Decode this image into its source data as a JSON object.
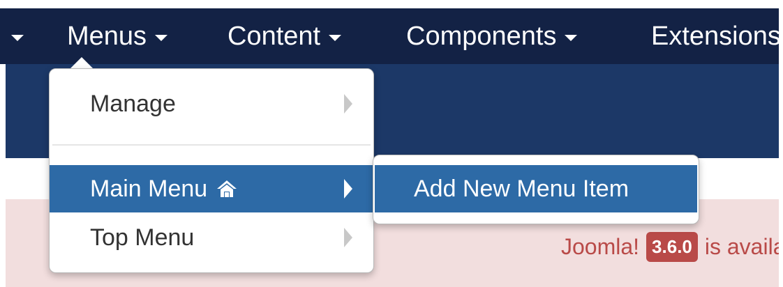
{
  "navbar": {
    "items": [
      {
        "label": "",
        "has_caret": true
      },
      {
        "label": "Menus",
        "has_caret": true
      },
      {
        "label": "Content",
        "has_caret": true
      },
      {
        "label": "Components",
        "has_caret": true
      },
      {
        "label": "Extensions",
        "has_caret": false
      }
    ]
  },
  "dropdown": {
    "items": [
      {
        "label": "Manage",
        "icon": "chevron-right-icon"
      },
      {
        "label": "Main Menu",
        "icon": "home-icon",
        "active": true
      },
      {
        "label": "Top Menu",
        "icon": "chevron-right-icon"
      }
    ]
  },
  "submenu": {
    "items": [
      {
        "label": "Add New Menu Item",
        "active": true
      }
    ]
  },
  "alert": {
    "prefix": "Joomla!",
    "version": "3.6.0",
    "suffix": "is available"
  },
  "colors": {
    "navbar_bg": "#132245",
    "subheader_bg": "#1c3867",
    "active_bg": "#2d6aa6",
    "alert_bg": "#f2dede",
    "alert_text": "#b94a48"
  }
}
